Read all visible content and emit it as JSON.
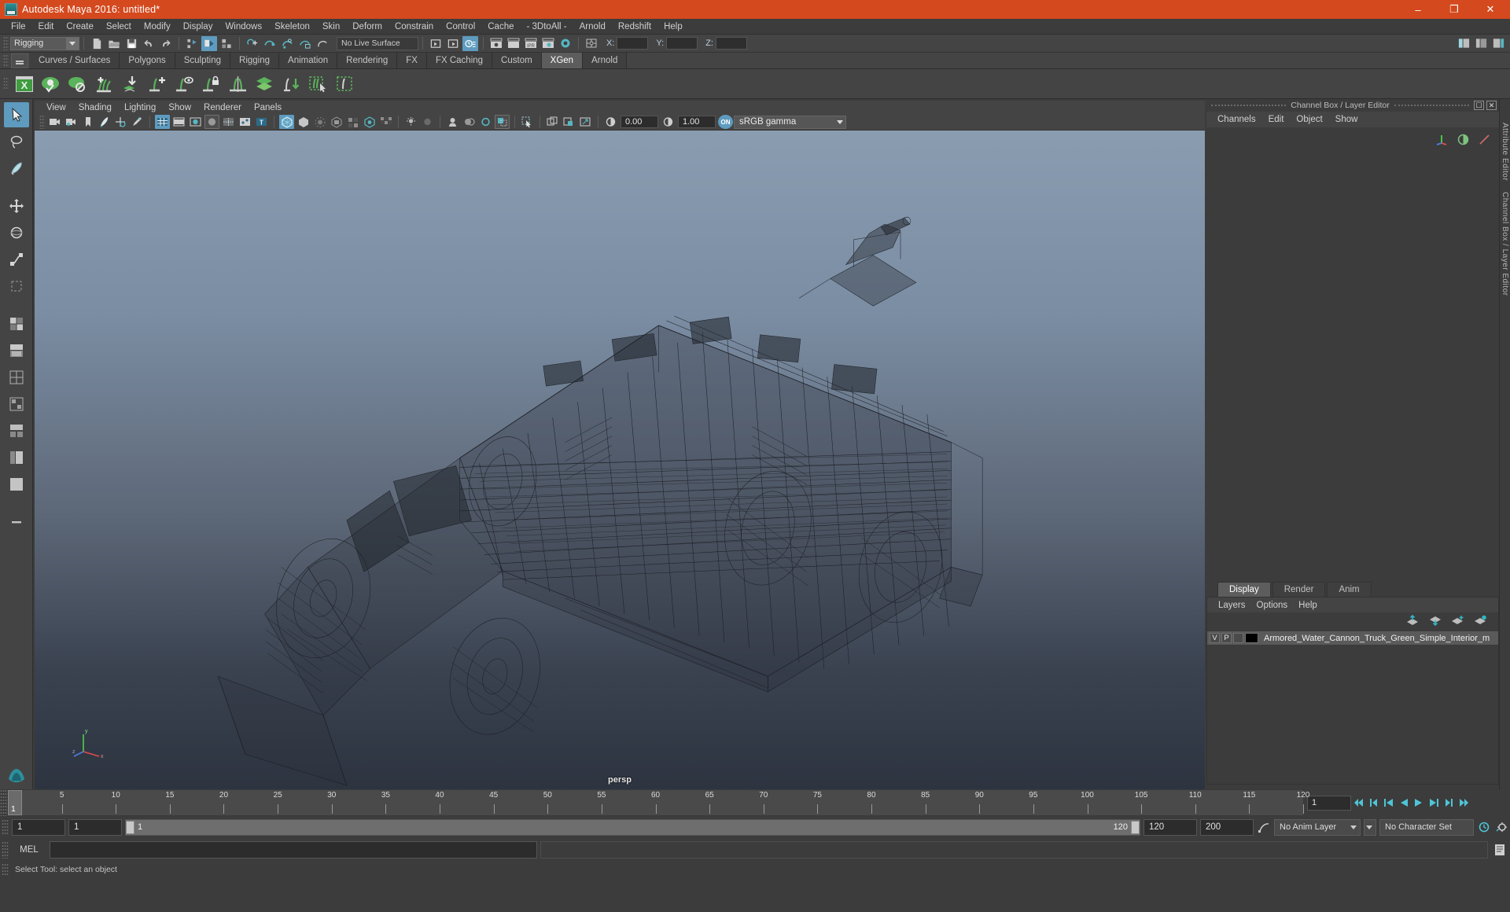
{
  "window": {
    "title": "Autodesk Maya 2016: untitled*",
    "app_icon": "maya-icon",
    "minimize": "–",
    "maximize": "❐",
    "close": "✕"
  },
  "menubar": {
    "items": [
      "File",
      "Edit",
      "Create",
      "Select",
      "Modify",
      "Display",
      "Windows",
      "Skeleton",
      "Skin",
      "Deform",
      "Constrain",
      "Control",
      "Cache",
      "- 3DtoAll -",
      "Arnold",
      "Redshift",
      "Help"
    ]
  },
  "statusbar": {
    "mode_selector": "Rigging",
    "live_surface": "No Live Surface",
    "x_label": "X:",
    "y_label": "Y:",
    "z_label": "Z:",
    "x_value": "",
    "y_value": "",
    "z_value": ""
  },
  "shelf": {
    "tabs": [
      "Curves / Surfaces",
      "Polygons",
      "Sculpting",
      "Rigging",
      "Animation",
      "Rendering",
      "FX",
      "FX Caching",
      "Custom",
      "XGen",
      "Arnold"
    ],
    "active_tab": "XGen",
    "icons": [
      "xgen-editor-icon",
      "xgen-preview-visible-icon",
      "xgen-preview-off-icon",
      "xgen-add-description-icon",
      "xgen-import-collection-icon",
      "xgen-add-grooming-icon",
      "xgen-preview-guide-icon",
      "xgen-lock-guide-icon",
      "xgen-mirror-guide-icon",
      "xgen-layers-icon",
      "xgen-convert-icon",
      "xgen-select-guides-icon",
      "xgen-region-icon"
    ]
  },
  "toolbox": {
    "items": [
      {
        "name": "select-tool-icon",
        "selected": true
      },
      {
        "name": "lasso-select-tool-icon",
        "selected": false
      },
      {
        "name": "paint-select-tool-icon",
        "selected": false
      },
      {
        "name": "move-tool-icon",
        "selected": false
      },
      {
        "name": "rotate-tool-icon",
        "selected": false
      },
      {
        "name": "scale-tool-icon",
        "selected": false
      },
      {
        "name": "last-tool-icon",
        "selected": false
      },
      {
        "name": "layout-four-view-icon",
        "selected": false
      },
      {
        "name": "layout-persp-outliner-icon",
        "selected": false
      },
      {
        "name": "layout-persp-graph-icon",
        "selected": false
      },
      {
        "name": "layout-hypershade-icon",
        "selected": false
      },
      {
        "name": "layout-persp-hypergraph-icon",
        "selected": false
      },
      {
        "name": "layout-outliner-persp-icon",
        "selected": false
      },
      {
        "name": "layout-single-icon",
        "selected": false
      },
      {
        "name": "layout-more-icon",
        "selected": false
      }
    ]
  },
  "viewport": {
    "menus": [
      "View",
      "Shading",
      "Lighting",
      "Show",
      "Renderer",
      "Panels"
    ],
    "camera_label": "persp",
    "exposure_value": "0.00",
    "gamma_value": "1.00",
    "color_management": "sRGB gamma",
    "color_management_enabled": "ON",
    "axis_x": "x",
    "axis_y": "y",
    "axis_z": "z",
    "model": "armored-water-cannon-truck-wireframe"
  },
  "channel_box": {
    "panel_title": "Channel Box / Layer Editor",
    "menus": [
      "Channels",
      "Edit",
      "Object",
      "Show"
    ],
    "undock_icon": "undock-icon",
    "close_icon": "close-icon"
  },
  "layer_editor": {
    "tabs": [
      "Display",
      "Render",
      "Anim"
    ],
    "active_tab": "Display",
    "menus": [
      "Layers",
      "Options",
      "Help"
    ],
    "tool_icons": [
      "move-layer-up-icon",
      "move-layer-down-icon",
      "new-layer-icon",
      "new-layer-from-selected-icon"
    ],
    "layers": [
      {
        "visibility": "V",
        "playback": "P",
        "shading": "",
        "color": "#000000",
        "name": "Armored_Water_Cannon_Truck_Green_Simple_Interior_m"
      }
    ]
  },
  "side_tabs": [
    "Attribute Editor",
    "Channel Box / Layer Editor"
  ],
  "timeline": {
    "current_frame": "1",
    "ticks": [
      5,
      10,
      15,
      20,
      25,
      30,
      35,
      40,
      45,
      50,
      55,
      60,
      65,
      70,
      75,
      80,
      85,
      90,
      95,
      100,
      105,
      110,
      115,
      120
    ],
    "range_start": 1,
    "range_end": 120,
    "frame_field": "1",
    "playback_buttons": [
      "go-to-start-icon",
      "step-back-key-icon",
      "step-back-frame-icon",
      "play-backwards-icon",
      "play-forwards-icon",
      "step-forward-frame-icon",
      "step-forward-key-icon",
      "go-to-end-icon"
    ]
  },
  "range_bar": {
    "anim_start": "1",
    "range_start": "1",
    "slider_start_label": "1",
    "slider_end_label": "120",
    "range_end": "120",
    "anim_end": "200",
    "anim_layer": "No Anim Layer",
    "character_set": "No Character Set",
    "anim_pref_icon": "animation-preferences-icon",
    "settings_icon": "settings-icon"
  },
  "command_line": {
    "language": "MEL",
    "input_value": "",
    "output_value": "",
    "script_editor_icon": "script-editor-icon"
  },
  "status_line": {
    "message": "Select Tool: select an object"
  },
  "colors": {
    "title_bar": "#d4491e",
    "panel_bg": "#3c3c3c",
    "toolbar_bg": "#444444",
    "accent": "#5e9bbf",
    "xgen_green": "#6eb459",
    "text": "#c8c8c8"
  }
}
